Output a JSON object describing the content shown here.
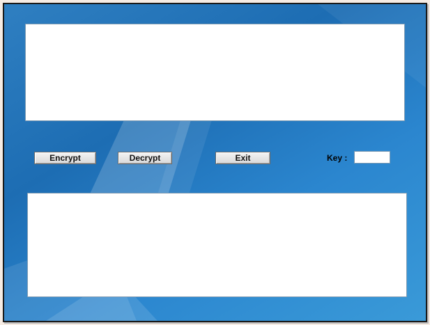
{
  "window": {
    "background_accent": "#1d6db3"
  },
  "input_area": {
    "value": ""
  },
  "output_area": {
    "value": ""
  },
  "toolbar": {
    "encrypt_label": "Encrypt",
    "decrypt_label": "Decrypt",
    "exit_label": "Exit"
  },
  "key": {
    "label": "Key :",
    "value": ""
  }
}
